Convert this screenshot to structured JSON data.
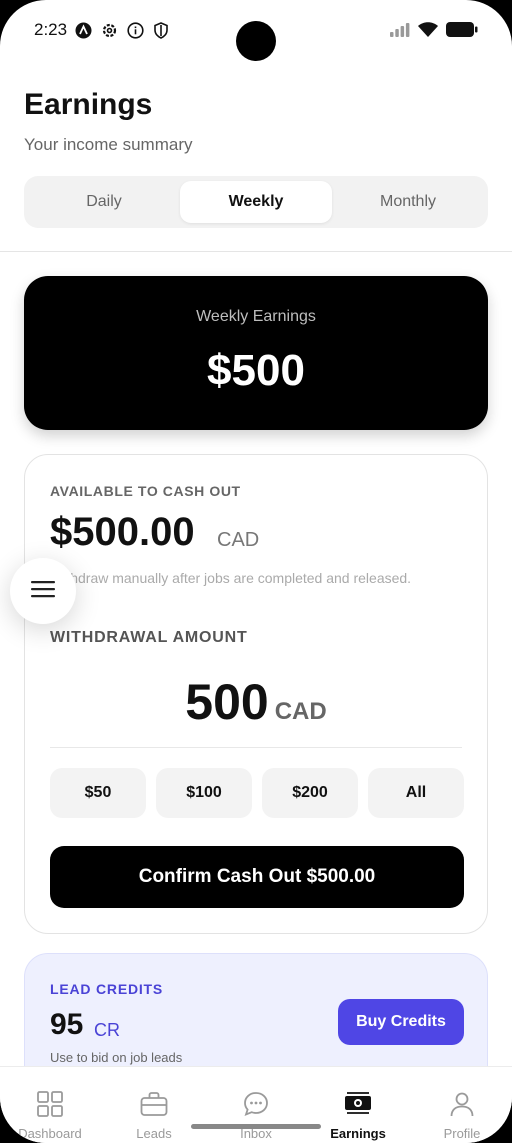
{
  "status_bar": {
    "time": "2:23",
    "icons_left": [
      "a-logo-icon",
      "gear-icon",
      "info-icon",
      "shield-icon"
    ],
    "icons_right": [
      "signal-icon",
      "wifi-icon",
      "battery-icon"
    ]
  },
  "header": {
    "title": "Earnings",
    "subtitle": "Your income summary"
  },
  "tabs": [
    {
      "label": "Daily",
      "active": false
    },
    {
      "label": "Weekly",
      "active": true
    },
    {
      "label": "Monthly",
      "active": false
    }
  ],
  "earnings_card": {
    "label": "Weekly Earnings",
    "amount": "$500"
  },
  "cashout": {
    "available_label": "AVAILABLE TO CASH OUT",
    "available_amount": "$500.00",
    "available_currency": "CAD",
    "note": "Withdraw manually after jobs are completed and released.",
    "withdrawal_label": "WITHDRAWAL AMOUNT",
    "withdrawal_amount": "500",
    "withdrawal_currency": "CAD",
    "presets": [
      "$50",
      "$100",
      "$200",
      "All"
    ],
    "confirm_label": "Confirm Cash Out $500.00"
  },
  "credits": {
    "label": "LEAD CREDITS",
    "value": "95",
    "unit": "CR",
    "note": "Use to bid on job leads",
    "buy_label": "Buy Credits"
  },
  "nav": [
    {
      "label": "Dashboard",
      "icon": "grid-icon",
      "active": false
    },
    {
      "label": "Leads",
      "icon": "briefcase-icon",
      "active": false
    },
    {
      "label": "Inbox",
      "icon": "chat-bubble-icon",
      "active": false
    },
    {
      "label": "Earnings",
      "icon": "money-icon",
      "active": true
    },
    {
      "label": "Profile",
      "icon": "person-icon",
      "active": false
    }
  ],
  "colors": {
    "accent": "#4f46e5",
    "accent_text": "#4a43d6",
    "credits_bg": "#eef0fe",
    "dark_card": "#000000"
  }
}
